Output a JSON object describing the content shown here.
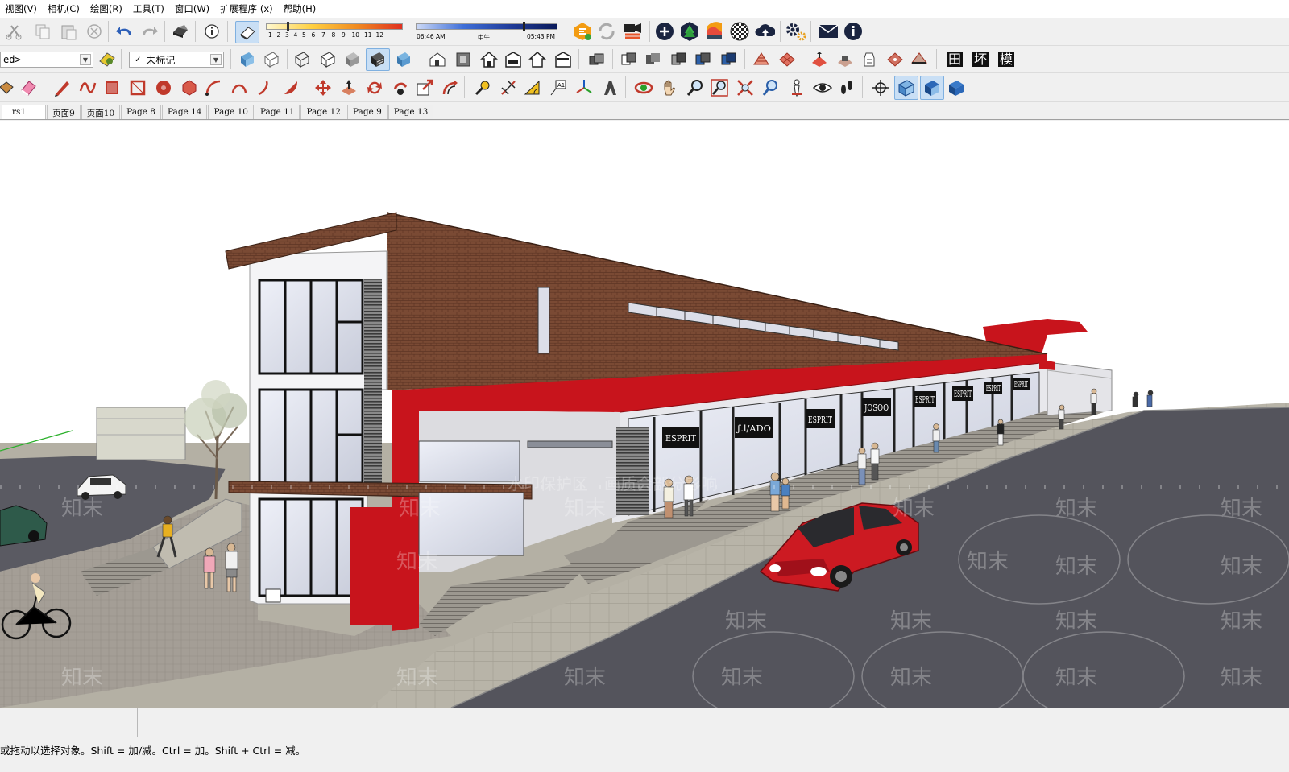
{
  "menu": [
    "视图(V)",
    "相机(C)",
    "绘图(R)",
    "工具(T)",
    "窗口(W)",
    "扩展程序 (x)",
    "帮助(H)"
  ],
  "shadow_scale": [
    "1",
    "2",
    "3",
    "4",
    "5",
    "6",
    "7",
    "8",
    "9",
    "10",
    "11",
    "12"
  ],
  "time": {
    "start": "06:46 AM",
    "mid": "中午",
    "end": "05:43 PM"
  },
  "style_combo": "ed>",
  "tag_combo": "未标记",
  "right_tools": {
    "t1": "田",
    "t2": "坏",
    "t3": "模"
  },
  "scenes": [
    "rs1",
    "页面9",
    "页面10",
    "Page 8",
    "Page 14",
    "Page 10",
    "Page 11",
    "Page 12",
    "Page 9",
    "Page 13"
  ],
  "watermark": {
    "brand": "知末",
    "notice": "水印保护区　画质会部分影响"
  },
  "storefront_signs": [
    "ESPRIT",
    "ƒ.l/ADO",
    "ESPRIT",
    "JOSOO",
    "ESPRIT",
    "ESPRIT",
    "ESPRIT",
    "ESPRIT"
  ],
  "status_hint": "或拖动以选择对象。Shift = 加/减。Ctrl = 加。Shift + Ctrl = 减。",
  "colors": {
    "brick": "#7a4a34",
    "accent_red": "#c8141c",
    "car_red": "#cc1a22",
    "road": "#54545c",
    "sidewalk": "#b4b0a4"
  }
}
